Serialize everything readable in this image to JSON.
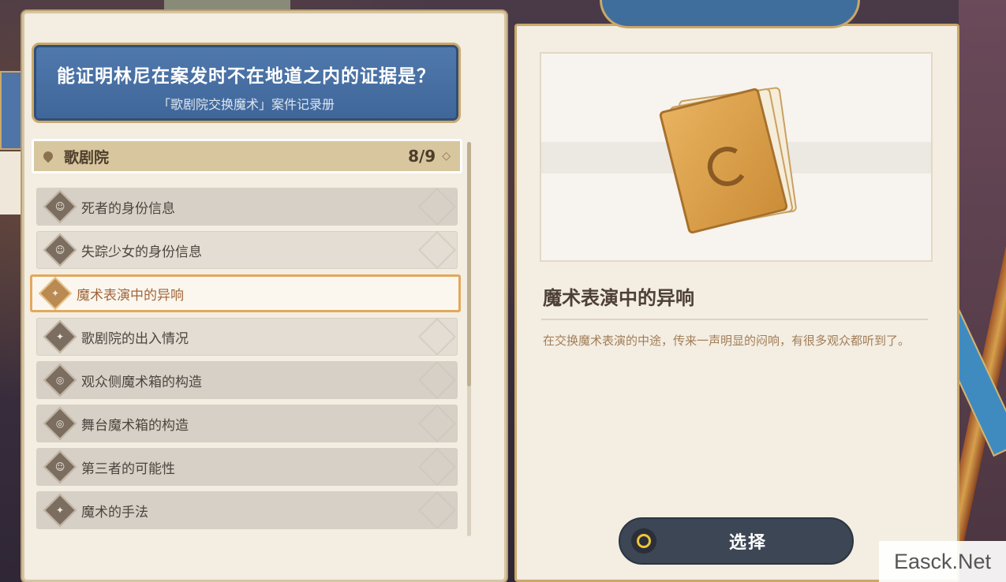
{
  "question": {
    "title": "能证明林尼在案发时不在地道之内的证据是？",
    "subtitle": "「歌剧院交换魔术」案件记录册"
  },
  "location": {
    "name": "歌剧院",
    "count": "8/9"
  },
  "clues": [
    {
      "label": "死者的身份信息",
      "icon": "portrait-icon"
    },
    {
      "label": "失踪少女的身份信息",
      "icon": "portrait-icon"
    },
    {
      "label": "魔术表演中的异响",
      "icon": "document-icon",
      "selected": true
    },
    {
      "label": "歌剧院的出入情况",
      "icon": "document-icon"
    },
    {
      "label": "观众侧魔术箱的构造",
      "icon": "keyhole-icon"
    },
    {
      "label": "舞台魔术箱的构造",
      "icon": "keyhole-icon"
    },
    {
      "label": "第三者的可能性",
      "icon": "portrait-icon"
    },
    {
      "label": "魔术的手法",
      "icon": "document-icon"
    }
  ],
  "detail": {
    "title": "魔术表演中的异响",
    "description": "在交换魔术表演的中途，传来一声明显的闷响，有很多观众都听到了。"
  },
  "actions": {
    "select_label": "选择"
  },
  "watermark": "Easck.Net",
  "colors": {
    "question_bg": "#4a72a6",
    "accent_gold": "#c9a86a",
    "selected_border": "#e2a85c",
    "button_bg": "#3c4654"
  }
}
